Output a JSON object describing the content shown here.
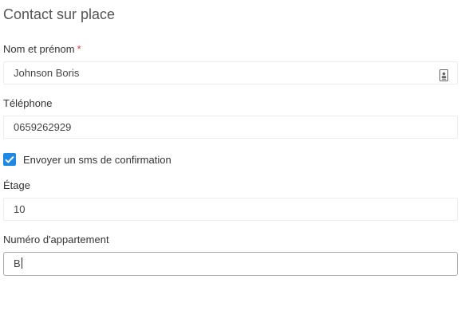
{
  "section": {
    "title": "Contact sur place"
  },
  "fields": {
    "name": {
      "label": "Nom et prénom",
      "required_mark": "*",
      "value": "Johnson Boris",
      "icon": "contact-card-icon"
    },
    "phone": {
      "label": "Téléphone",
      "value": "0659262929"
    },
    "sms": {
      "label": "Envoyer un sms de confirmation",
      "checked": true
    },
    "floor": {
      "label": "Étage",
      "value": "10"
    },
    "apartment": {
      "label": "Numéro d'appartement",
      "value": "B"
    }
  },
  "colors": {
    "checkbox": "#1e88e5",
    "required": "#e53935"
  }
}
